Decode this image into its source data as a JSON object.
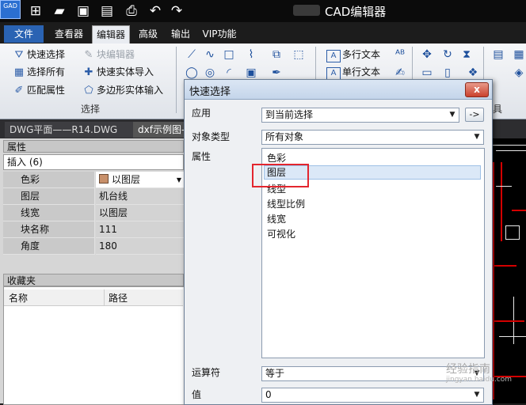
{
  "app": {
    "title": "CAD编辑器",
    "logo_text": "GAD"
  },
  "ribbon_tabs": [
    "文件",
    "查看器",
    "编辑器",
    "高级",
    "输出",
    "VIP功能"
  ],
  "ribbon": {
    "items": [
      {
        "label": "快速选择",
        "icon": "filter-icon"
      },
      {
        "label": "块编辑器",
        "icon": "block-edit-icon",
        "disabled": true
      },
      {
        "label": "选择所有",
        "icon": "select-all-icon"
      },
      {
        "label": "快速实体导入",
        "icon": "import-icon"
      },
      {
        "label": "匹配属性",
        "icon": "brush-icon"
      },
      {
        "label": "多边形实体输入",
        "icon": "polygon-icon"
      }
    ],
    "group_label": "选择",
    "text_items": [
      "多行文本",
      "单行文本"
    ],
    "right_group_label": "具"
  },
  "documents": [
    "DWG平面——R14.DWG",
    "dxf示例图-"
  ],
  "properties": {
    "header": "属性",
    "selector": "插入 (6)",
    "rows": [
      {
        "key": "色彩",
        "value": "以图层"
      },
      {
        "key": "图层",
        "value": "机台线"
      },
      {
        "key": "线宽",
        "value": "以图层"
      },
      {
        "key": "块名称",
        "value": "111"
      },
      {
        "key": "角度",
        "value": "180"
      }
    ]
  },
  "favorites": {
    "header": "收藏夹",
    "columns": [
      "名称",
      "路径"
    ]
  },
  "dialog": {
    "title": "快速选择",
    "close_label": "x",
    "apply_label": "应用",
    "apply_value": "到当前选择",
    "apply_button": "->",
    "object_type_label": "对象类型",
    "object_type_value": "所有对象",
    "property_label": "属性",
    "properties": [
      "色彩",
      "图层",
      "线型",
      "线型比例",
      "线宽",
      "可视化"
    ],
    "selected_property": "图层",
    "operator_label": "运算符",
    "operator_value": "等于",
    "value_label": "值",
    "value_value": "0"
  },
  "watermark": {
    "text": "经验指南",
    "url": "jingyan.baidu.com"
  },
  "colors": {
    "accent": "#2a63b3",
    "highlight": "#e3262e",
    "swatch": "#c8906a"
  }
}
